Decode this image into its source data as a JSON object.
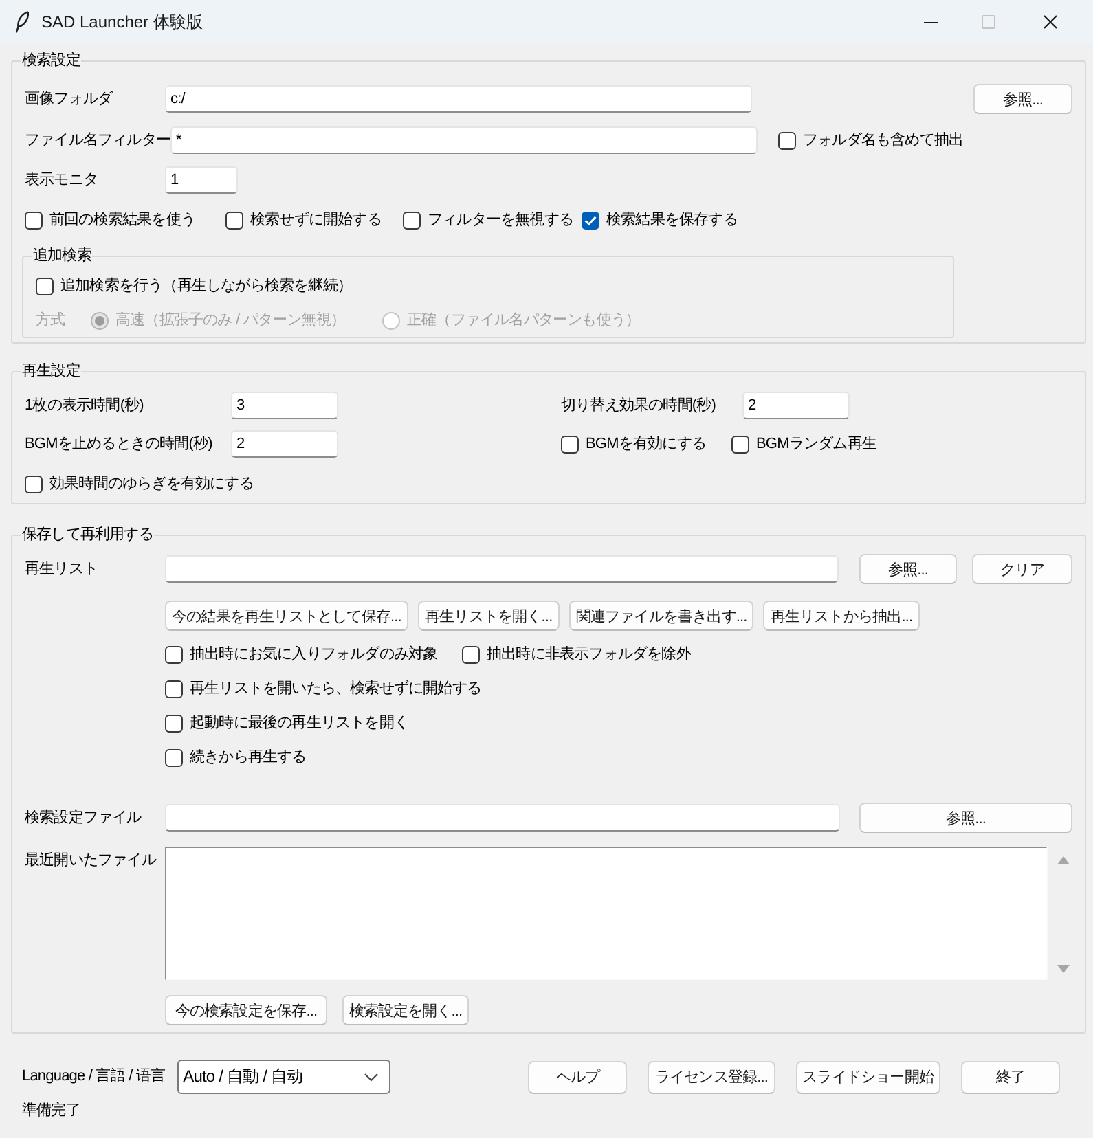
{
  "window": {
    "title": "SAD Launcher 体験版",
    "maximize_disabled": true
  },
  "search_settings": {
    "title": "検索設定",
    "image_folder": {
      "label": "画像フォルダ",
      "value": "c:/",
      "button": "参照..."
    },
    "file_filter": {
      "label": "ファイル名フィルター",
      "value": "*",
      "option": {
        "label": "フォルダ名も含めて抽出",
        "checked": false
      }
    },
    "monitor": {
      "label": "表示モニタ",
      "value": "1"
    },
    "options": [
      {
        "label": "前回の検索結果を使う",
        "checked": false
      },
      {
        "label": "検索せずに開始する",
        "checked": false
      },
      {
        "label": "フィルターを無視する",
        "checked": false
      },
      {
        "label": "検索結果を保存する",
        "checked": true
      }
    ],
    "additional_search": {
      "title": "追加検索",
      "enable": {
        "label": "追加検索を行う（再生しながら検索を継続）",
        "checked": false
      },
      "method": {
        "label": "方式",
        "disabled": true,
        "choices": [
          {
            "label": "高速（拡張子のみ / パターン無視）",
            "selected": true
          },
          {
            "label": "正確（ファイル名パターンも使う）",
            "selected": false
          }
        ]
      }
    }
  },
  "playback_settings": {
    "title": "再生設定",
    "display_time": {
      "label": "1枚の表示時間(秒)",
      "value": "3"
    },
    "transition_time": {
      "label": "切り替え効果の時間(秒)",
      "value": "2"
    },
    "bgm_fade_time": {
      "label": "BGMを止めるときの時間(秒)",
      "value": "2"
    },
    "bgm_options": [
      {
        "label": "BGMを有効にする",
        "checked": false
      },
      {
        "label": "BGMランダム再生",
        "checked": false
      }
    ],
    "jitter": {
      "label": "効果時間のゆらぎを有効にする",
      "checked": false
    }
  },
  "save_reuse": {
    "title": "保存して再利用する",
    "playlist": {
      "label": "再生リスト",
      "buttons": [
        "参照...",
        "クリア"
      ]
    },
    "playlist_actions": [
      "今の結果を再生リストとして保存...",
      "再生リストを開く...",
      "関連ファイルを書き出す...",
      "再生リストから抽出..."
    ],
    "extract_options": [
      {
        "label": "抽出時にお気に入りフォルダのみ対象",
        "checked": false
      },
      {
        "label": "抽出時に非表示フォルダを除外",
        "checked": false
      }
    ],
    "playlist_options": [
      {
        "label": "再生リストを開いたら、検索せずに開始する",
        "checked": false
      },
      {
        "label": "起動時に最後の再生リストを開く",
        "checked": false
      },
      {
        "label": "続きから再生する",
        "checked": false
      }
    ],
    "settings_file": {
      "label": "検索設定ファイル",
      "button": "参照..."
    },
    "recent_files": {
      "label": "最近開いたファイル"
    },
    "settings_actions": [
      "今の検索設定を保存...",
      "検索設定を開く..."
    ]
  },
  "footer": {
    "language": {
      "label": "Language / 言語 / 语言",
      "value": "Auto / 自動 / 自动"
    },
    "buttons": [
      "ヘルプ",
      "ライセンス登録...",
      "スライドショー開始",
      "終了"
    ],
    "status": "準備完了"
  }
}
